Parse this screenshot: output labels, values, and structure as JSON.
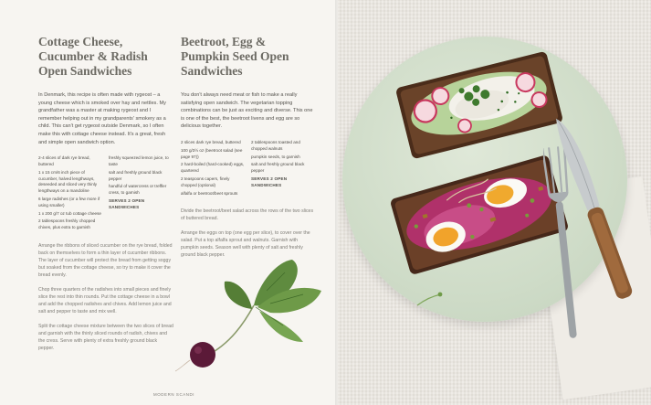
{
  "recipe_1": {
    "title": "Cottage Cheese, Cucumber & Radish Open Sandwiches",
    "intro": "In Denmark, this recipe is often made with rygeost – a young cheese which is smoked over hay and nettles. My grandfather was a master at making rygeost and I remember helping out in my grandparents' smokery as a child. This can't get rygeost outside Denmark, so I often make this with cottage cheese instead. It's a great, fresh and simple open sandwich option.",
    "ingredients_a": [
      "2-4 slices of dark rye bread, buttered",
      "1 x 15 cm/6 inch piece of cucumber, halved lengthways, deseeded and sliced very thinly lengthways on a mandoline",
      "6 large radishes (or a few more if using smaller)",
      "1 x 200 g/7 oz tub cottage cheese",
      "2 tablespoons freshly chopped chives, plus extra to garnish"
    ],
    "ingredients_b": [
      "freshly squeezed lemon juice, to taste",
      "salt and freshly ground black pepper",
      "handful of watercress or treffler cress, to garnish",
      "SERVES 2 OPEN SANDWICHES"
    ],
    "method": [
      "Arrange the ribbons of sliced cucumber on the rye bread, folded back on themselves to form a thin layer of cucumber ribbons. The layer of cucumber will protect the bread from getting soggy but soaked from the cottage cheese, so try to make it cover the bread evenly.",
      "Chop three quarters of the radishes into small pieces and finely slice the rest into thin rounds. Put the cottage cheese in a bowl and add the chopped radishes and chives. Add lemon juice and salt and pepper to taste and mix well.",
      "Split the cottage cheese mixture between the two slices of bread and garnish with the thinly sliced rounds of radish, chives and the cress. Serve with plenty of extra freshly ground black pepper."
    ]
  },
  "recipe_2": {
    "title": "Beetroot, Egg & Pumpkin Seed Open Sandwiches",
    "intro": "You don't always need meat or fish to make a really satisfying open sandwich. The vegetarian topping combinations can be just as exciting and diverse. This one is one of the best, the beetroot livens and egg are so delicious together.",
    "ingredients_a": [
      "2 slices dark rye bread, buttered",
      "100 g/3½ oz (beetroot salad (see page 97))",
      "2 hard-boiled (hard-cooked) eggs, quartered",
      "2 teaspoons capers, finely chopped (optional)",
      "alfalfa or beetroot/beet sprouts"
    ],
    "ingredients_b": [
      "2 tablespoons toasted and chopped walnuts",
      "pumpkin seeds, to garnish",
      "salt and freshly ground black pepper",
      "SERVES 2 OPEN SANDWICHES"
    ],
    "method": [
      "Divide the beetroot/beet salad across the rows of the two slices of buttered bread.",
      "Arrange the eggs on top (one egg per slice), to cover over the salad. Put a top alfalfa sprout and walnuts. Garnish with pumpkin seeds. Season well with plenty of salt and freshly ground black pepper."
    ]
  },
  "footer": "MODERN SCANDI"
}
